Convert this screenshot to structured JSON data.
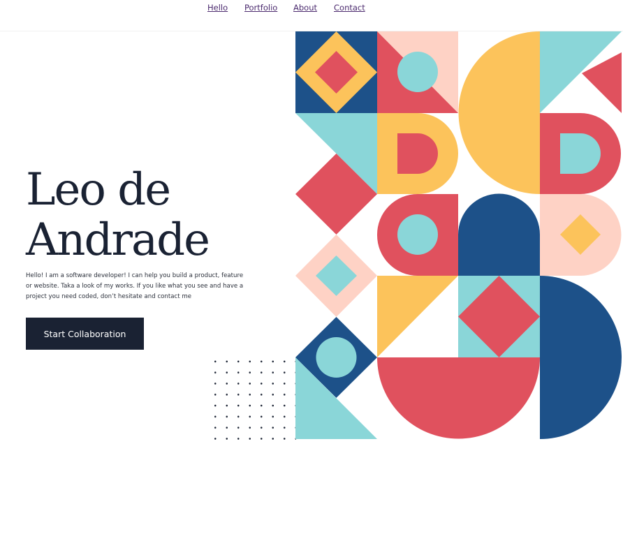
{
  "nav": {
    "items": [
      "Hello",
      "Portfolio",
      "About",
      "Contact"
    ]
  },
  "hero": {
    "title_line1": "Leo de",
    "title_line2": "Andrade",
    "description": "Hello! I am a software developer! I can help you build a product, feature or website. Taka a look of my works. If you like what you see and have a project you need coded, don’t hesitate and contact me",
    "cta_label": "Start Collaboration"
  },
  "colors": {
    "navy": "#1d5189",
    "red": "#e0515e",
    "yellow": "#fcc35b",
    "teal": "#8ad6d8",
    "peach": "#fed2c5",
    "dark": "#1a2233",
    "link": "#4b2a6e"
  }
}
